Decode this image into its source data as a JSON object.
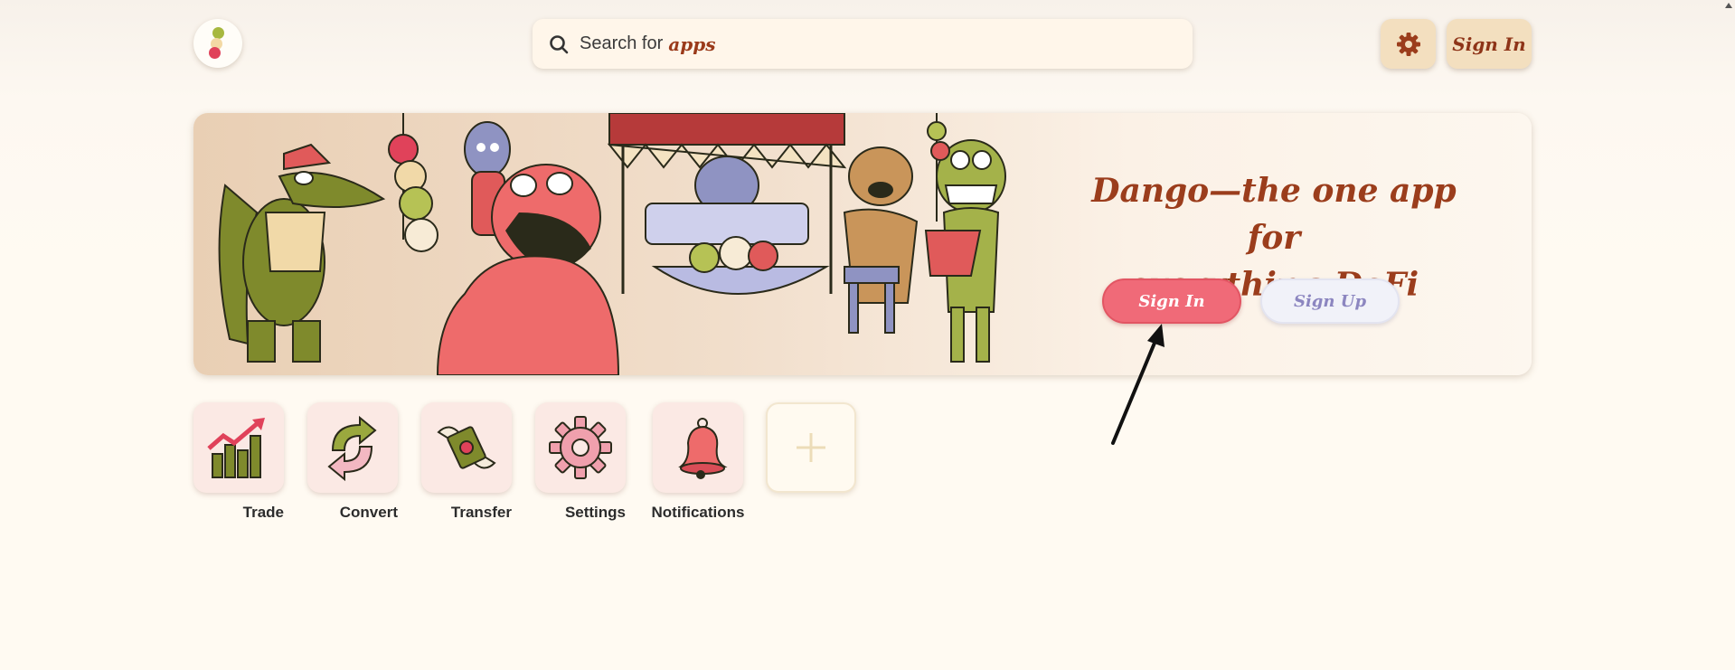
{
  "header": {
    "logo_icon": "dango-logo-icon",
    "search": {
      "prefix": "Search for",
      "emphasis": "apps",
      "icon": "search-icon"
    },
    "settings_icon": "gear-icon",
    "sign_in_label": "Sign In"
  },
  "banner": {
    "headline_line1": "Dango—the one app for",
    "headline_line2": "everything DeFi",
    "sign_in_label": "Sign In",
    "sign_up_label": "Sign Up",
    "illustration": "cartoon-characters-illustration"
  },
  "apps": [
    {
      "label": "Trade",
      "icon": "trade-chart-icon"
    },
    {
      "label": "Convert",
      "icon": "convert-arrows-icon"
    },
    {
      "label": "Transfer",
      "icon": "transfer-money-icon"
    },
    {
      "label": "Settings",
      "icon": "settings-gear-icon"
    },
    {
      "label": "Notifications",
      "icon": "bell-icon"
    }
  ],
  "add_app_icon": "plus-icon",
  "colors": {
    "accent_brown": "#9b3d1c",
    "sign_in_pink": "#f06a78",
    "sign_up_lavender": "#8c86c0",
    "tile_bg": "#fbe9e4",
    "olive": "#7f8a2c"
  }
}
